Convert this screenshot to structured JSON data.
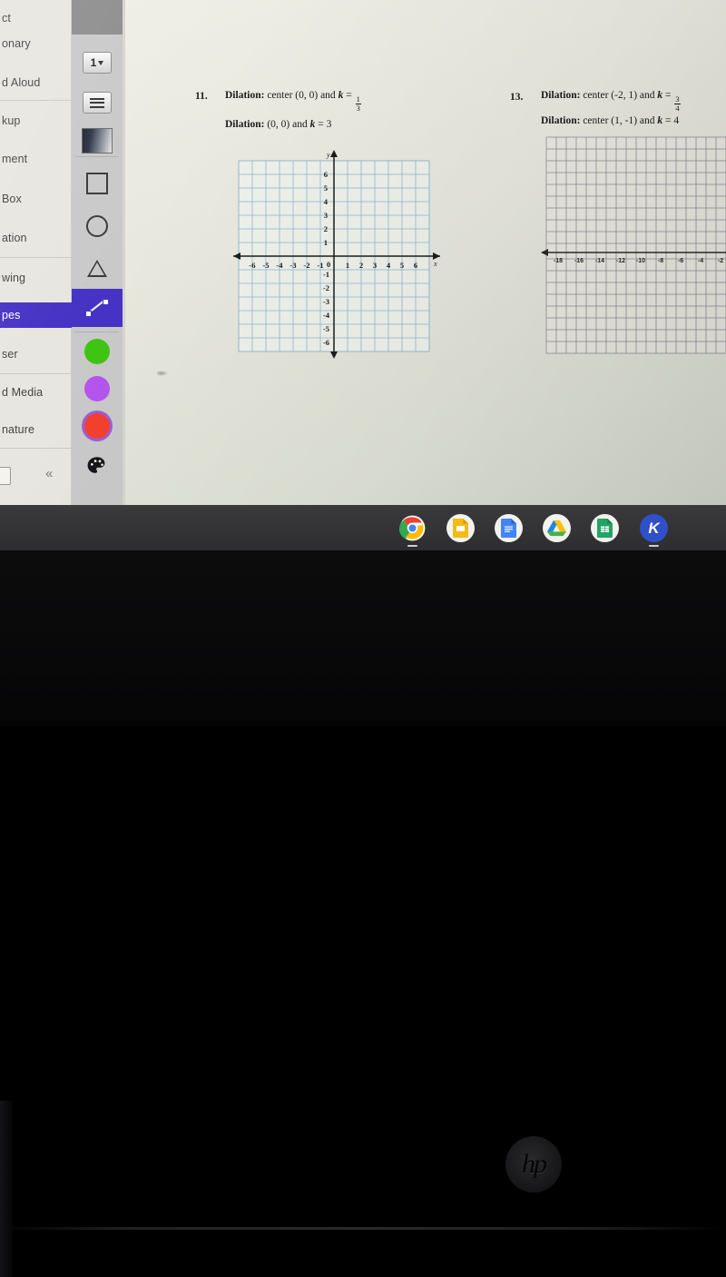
{
  "app": {
    "name": "Kami",
    "sidebar": {
      "items": [
        {
          "label": "ct",
          "selected": false
        },
        {
          "label": "onary",
          "selected": false
        },
        {
          "label": "d Aloud",
          "selected": false
        },
        {
          "label": "kup",
          "selected": false
        },
        {
          "label": "ment",
          "selected": false
        },
        {
          "label": "Box",
          "selected": false
        },
        {
          "label": "ation",
          "selected": false
        },
        {
          "label": "wing",
          "selected": false
        },
        {
          "label": "pes",
          "selected": true
        },
        {
          "label": "ser",
          "selected": false
        },
        {
          "label": "d Media",
          "selected": false
        },
        {
          "label": "nature",
          "selected": false
        }
      ],
      "collapse_glyph": "«"
    },
    "palette": {
      "line_width_value": "1",
      "tools": [
        {
          "name": "line-width-dropdown",
          "label": "1"
        },
        {
          "name": "line-style-tool",
          "label": ""
        },
        {
          "name": "opacity-gradient-swatch",
          "label": ""
        },
        {
          "name": "square-shape-tool",
          "label": ""
        },
        {
          "name": "circle-shape-tool",
          "label": ""
        },
        {
          "name": "triangle-shape-tool",
          "label": ""
        },
        {
          "name": "line-shape-tool",
          "label": ""
        }
      ],
      "colors": [
        {
          "name": "green",
          "hex": "#3ec412",
          "selected": false
        },
        {
          "name": "purple",
          "hex": "#b455ed",
          "selected": false
        },
        {
          "name": "red",
          "hex": "#f4402e",
          "selected": true
        }
      ],
      "palette_icon": "color-palette"
    }
  },
  "document": {
    "problems": [
      {
        "number": "11.",
        "lines": [
          {
            "bold_lead": "Dilation:",
            "text": " center (0, 0) and ",
            "var": "k",
            "eq": " = ",
            "frac": {
              "num": "1",
              "den": "3"
            },
            "plain_value": ""
          },
          {
            "bold_lead": "Dilation:",
            "text": " (0, 0) and ",
            "var": "k",
            "eq": " = ",
            "frac": null,
            "plain_value": "3"
          }
        ]
      },
      {
        "number": "13.",
        "lines": [
          {
            "bold_lead": "Dilation:",
            "text": " center (-2, 1) and ",
            "var": "k",
            "eq": " = ",
            "frac": {
              "num": "3",
              "den": "4"
            },
            "plain_value": ""
          },
          {
            "bold_lead": "Dilation:",
            "text": " center (1, -1) and ",
            "var": "k",
            "eq": " = ",
            "frac": null,
            "plain_value": "4"
          }
        ]
      }
    ]
  },
  "chart_data": [
    {
      "type": "grid",
      "name": "coordinate-plane-problem-11",
      "title": "",
      "xlabel": "x",
      "ylabel": "y",
      "xlim": [
        -7,
        7
      ],
      "ylim": [
        -7,
        7
      ],
      "xticks": [
        -6,
        -5,
        -4,
        -3,
        -2,
        -1,
        0,
        1,
        2,
        3,
        4,
        5,
        6
      ],
      "yticks": [
        6,
        5,
        4,
        3,
        2,
        1,
        0,
        -1,
        -2,
        -3,
        -4,
        -5,
        -6
      ],
      "xtick_labels": [
        "-6",
        "-5",
        "-4",
        "-3",
        "-2",
        "-1",
        "0",
        "1",
        "2",
        "3",
        "4",
        "5",
        "6"
      ],
      "ytick_labels": [
        "6",
        "5",
        "4",
        "3",
        "2",
        "1",
        "0",
        "-1",
        "-2",
        "-3",
        "-4",
        "-5",
        "-6"
      ],
      "grid": true,
      "grid_color": "#8fb9cc",
      "axis_color": "#1c1c1c",
      "series": [],
      "legend": "none"
    },
    {
      "type": "grid",
      "name": "coordinate-plane-problem-13",
      "title": "",
      "xlabel": "",
      "ylabel": "",
      "xlim": [
        -19,
        -1
      ],
      "ylim": [
        -9,
        9
      ],
      "xticks": [
        -18,
        -16,
        -14,
        -12,
        -10,
        -8,
        -6,
        -4,
        -2
      ],
      "xtick_labels": [
        "-18",
        "-16",
        "-14",
        "-12",
        "-10",
        "-8",
        "-6",
        "-4",
        "-2"
      ],
      "ytick_labels": [],
      "grid": true,
      "grid_color": "#8b8a95",
      "axis_color": "#2a2a2a",
      "series": [],
      "legend": "none"
    }
  ],
  "shelf": {
    "apps": [
      {
        "name": "chrome",
        "label": "Chrome",
        "running": true
      },
      {
        "name": "google-slides",
        "label": "Slides",
        "running": false
      },
      {
        "name": "google-docs",
        "label": "Docs",
        "running": false
      },
      {
        "name": "google-drive",
        "label": "Drive",
        "running": false
      },
      {
        "name": "google-sheets",
        "label": "Sheets",
        "running": false
      },
      {
        "name": "kami",
        "label": "K",
        "running": true
      }
    ]
  },
  "device": {
    "brand_glyph": "hp"
  }
}
